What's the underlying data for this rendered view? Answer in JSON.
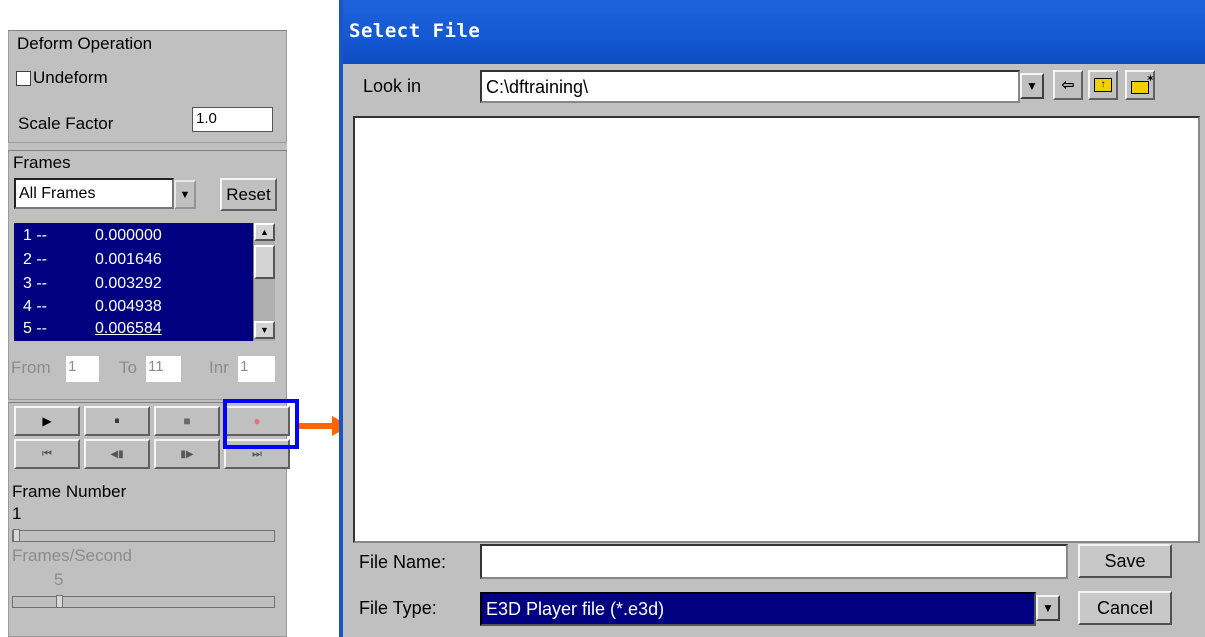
{
  "left_panel": {
    "deform": {
      "title": "Deform Operation",
      "undeform_label": "Undeform",
      "scale_label": "Scale Factor",
      "scale_value": "1.0"
    },
    "frames": {
      "title": "Frames",
      "select_value": "All Frames",
      "reset_label": "Reset",
      "list": [
        {
          "index": "1 --",
          "value": "0.000000"
        },
        {
          "index": "2 --",
          "value": "0.001646"
        },
        {
          "index": "3 --",
          "value": "0.003292"
        },
        {
          "index": "4 --",
          "value": "0.004938"
        },
        {
          "index": "5 --",
          "value": "0.006584"
        }
      ],
      "from_label": "From",
      "from_value": "1",
      "to_label": "To",
      "to_value": "11",
      "inr_label": "Inr",
      "inr_value": "1"
    },
    "playback": {
      "buttons": [
        {
          "name": "play-button",
          "icon": "▶"
        },
        {
          "name": "pause-button",
          "icon": "⏸"
        },
        {
          "name": "stop-button",
          "icon": "■"
        },
        {
          "name": "record-button",
          "icon": "●"
        },
        {
          "name": "first-frame-button",
          "icon": "⏮"
        },
        {
          "name": "step-back-button",
          "icon": "◀▮"
        },
        {
          "name": "step-forward-button",
          "icon": "▮▶"
        },
        {
          "name": "last-frame-button",
          "icon": "⏭"
        }
      ],
      "frame_number_label": "Frame Number",
      "frame_number_value": "1",
      "frame_slider_fraction": 0,
      "fps_label": "Frames/Second",
      "fps_value": "5",
      "fps_slider_fraction": 0.17
    }
  },
  "dialog": {
    "title": "Select File",
    "look_in_label": "Look in",
    "look_in_value": "C:\\dftraining\\",
    "toolbar_icons": [
      "back-icon",
      "up-folder-icon",
      "new-folder-icon"
    ],
    "file_name_label": "File Name:",
    "file_name_value": "",
    "file_type_label": "File Type:",
    "file_type_value": "E3D Player file (*.e3d)",
    "save_label": "Save",
    "cancel_label": "Cancel"
  },
  "colors": {
    "title_bar": "#1458d2",
    "selection": "#000080",
    "highlight_box": "#0000ff",
    "arrow": "#ff6600",
    "record_dot": "#e87070"
  }
}
